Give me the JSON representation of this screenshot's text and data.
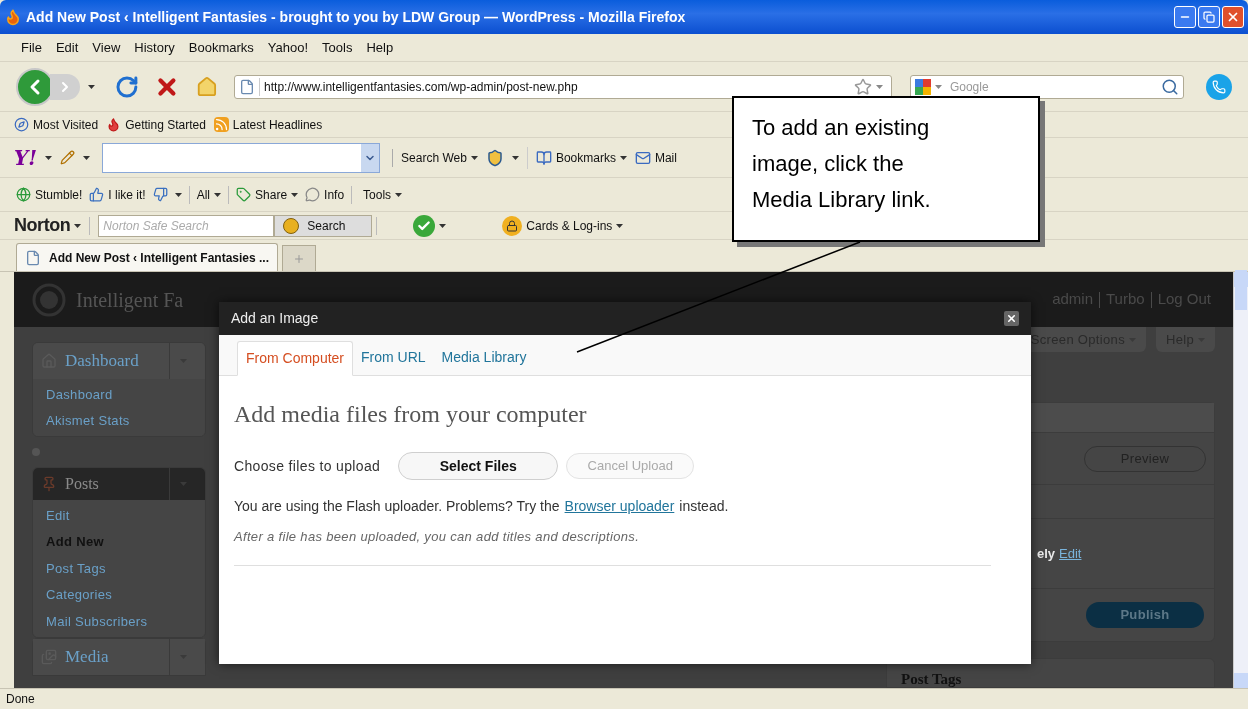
{
  "window": {
    "title": "Add New Post ‹ Intelligent Fantasies - brought to you by LDW Group — WordPress - Mozilla Firefox"
  },
  "menu": [
    "File",
    "Edit",
    "View",
    "History",
    "Bookmarks",
    "Yahoo!",
    "Tools",
    "Help"
  ],
  "navigation": {
    "url": "http://www.intelligentfantasies.com/wp-admin/post-new.php",
    "search_placeholder": "Google"
  },
  "bookmarks": [
    "Most Visited",
    "Getting Started",
    "Latest Headlines"
  ],
  "yahoo_toolbar": {
    "logo": "Y!",
    "search_button": "Search Web",
    "bookmarks": "Bookmarks",
    "mail": "Mail"
  },
  "stumble_toolbar": {
    "stumble": "Stumble!",
    "like": "I like it!",
    "all": "All",
    "share": "Share",
    "info": "Info",
    "tools": "Tools"
  },
  "norton_toolbar": {
    "brand": "Norton",
    "search_placeholder": "Norton Safe Search",
    "search_button": "Search",
    "cards": "Cards & Log-ins"
  },
  "tabs": [
    {
      "label": "Add New Post ‹ Intelligent Fantasies ...",
      "selected": true
    }
  ],
  "wp_header": {
    "site": "Intelligent Fa",
    "user_links": [
      "admin",
      "Turbo",
      "Log Out"
    ]
  },
  "sidebar": {
    "menus": [
      {
        "label": "Dashboard",
        "selected": false,
        "items": [
          {
            "label": "Dashboard",
            "selected": false
          },
          {
            "label": "Akismet Stats",
            "selected": false
          }
        ]
      },
      {
        "label": "Posts",
        "selected": true,
        "items": [
          {
            "label": "Edit",
            "selected": false
          },
          {
            "label": "Add New",
            "selected": true
          },
          {
            "label": "Post Tags",
            "selected": false
          },
          {
            "label": "Categories",
            "selected": false
          },
          {
            "label": "Mail Subscribers",
            "selected": false
          }
        ]
      },
      {
        "label": "Media",
        "selected": false
      }
    ]
  },
  "screen_meta": [
    "Screen Options",
    "Help"
  ],
  "publish_box": {
    "preview": "Preview",
    "status_tail": "ely",
    "edit_link": "Edit",
    "publish": "Publish"
  },
  "post_tags_box": {
    "title": "Post Tags"
  },
  "dialog": {
    "title": "Add an Image",
    "tabs": [
      {
        "label": "From Computer",
        "selected": true
      },
      {
        "label": "From URL",
        "selected": false
      },
      {
        "label": "Media Library",
        "selected": false
      }
    ],
    "heading": "Add media files from your computer",
    "choose_label": "Choose files to upload",
    "select_button": {
      "label": "Select Files",
      "disabled": false
    },
    "cancel_button": {
      "label": "Cancel Upload",
      "disabled": true
    },
    "flash_note": "You are using the Flash uploader. Problems? Try the",
    "flash_link": "Browser uploader",
    "flash_note_end": "instead.",
    "hint": "After a file has been uploaded, you can add titles and descriptions."
  },
  "callout": {
    "text": "To add an existing image, click the Media Library link."
  },
  "status_bar": {
    "text": "Done"
  }
}
